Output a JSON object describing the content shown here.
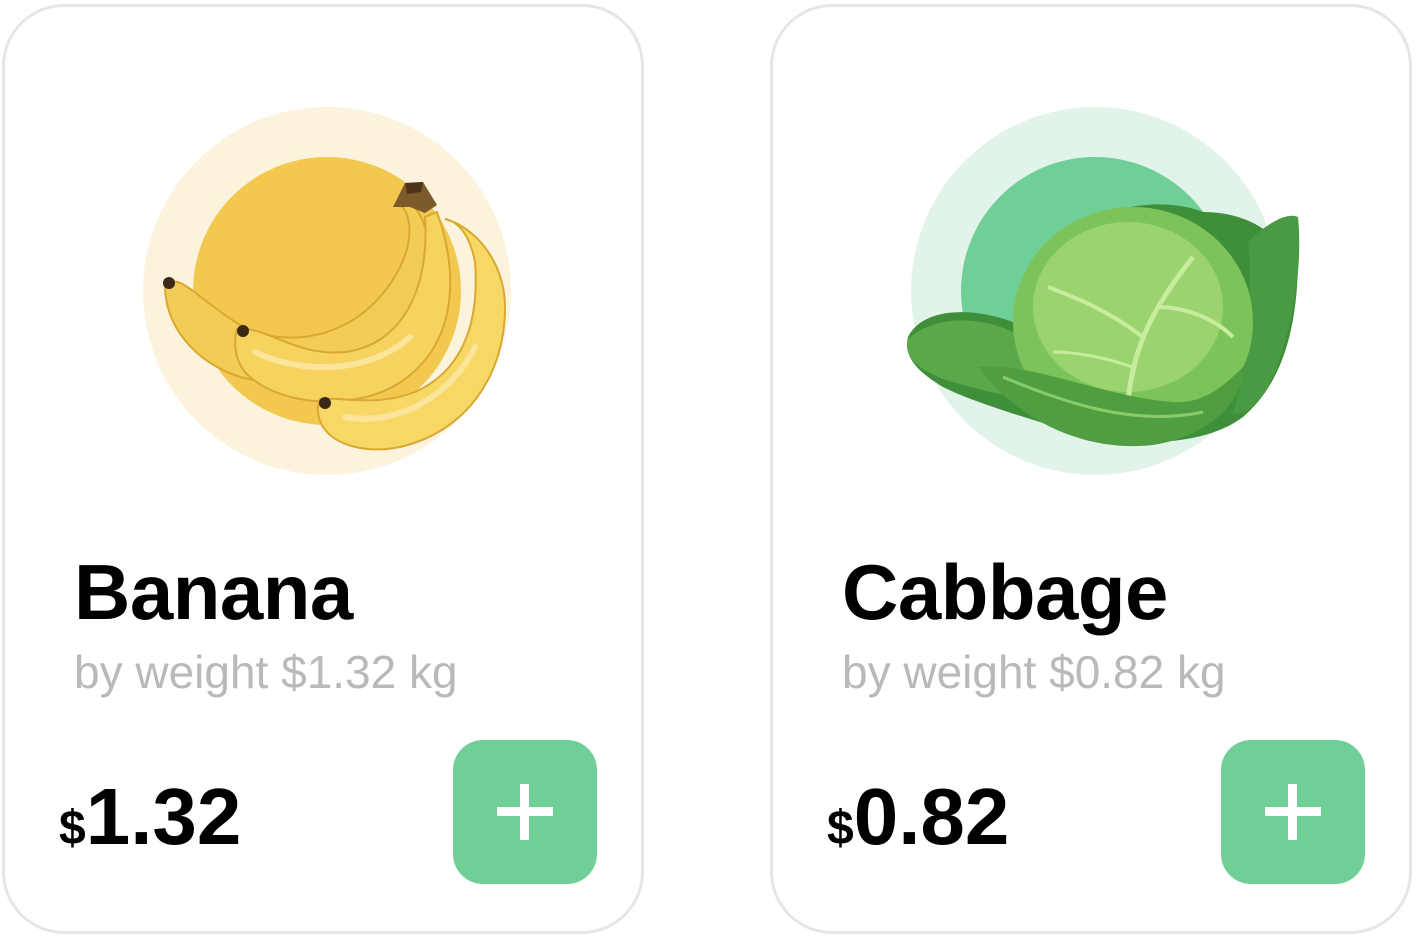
{
  "products": [
    {
      "name": "Banana",
      "subtitle": "by weight $1.32 kg",
      "currency": "$",
      "price": "1.32",
      "image_icon": "banana-image",
      "outer_circle_color": "#fbf3dc",
      "inner_circle_color": "#f3c84f"
    },
    {
      "name": "Cabbage",
      "subtitle": "by weight $0.82 kg",
      "currency": "$",
      "price": "0.82",
      "image_icon": "cabbage-image",
      "outer_circle_color": "#e2f4e9",
      "inner_circle_color": "#6fcf97"
    }
  ],
  "add_button": {
    "icon": "plus-icon",
    "color": "#6fcf97"
  }
}
